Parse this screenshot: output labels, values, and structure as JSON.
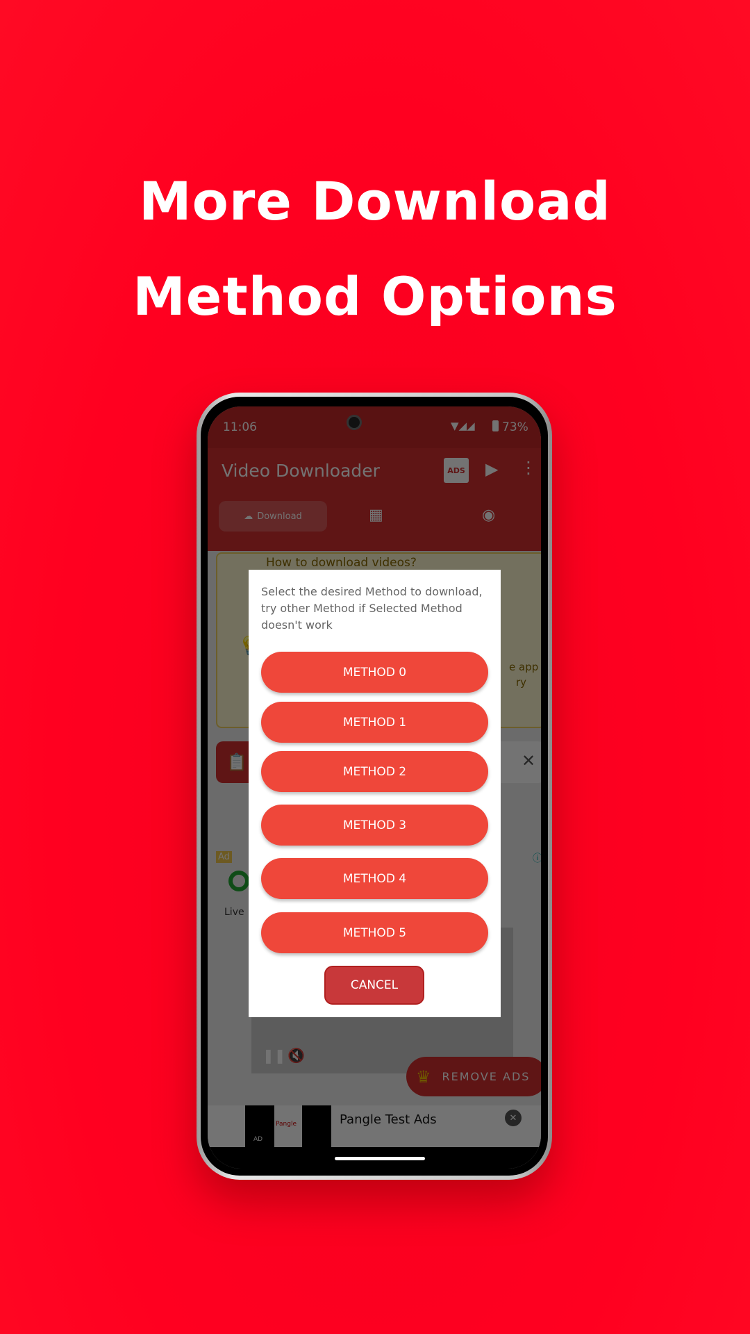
{
  "headline": {
    "line1": "More Download",
    "line2": "Method Options"
  },
  "status": {
    "time": "11:06",
    "battery": "73%"
  },
  "app": {
    "title": "Video Downloader",
    "ads_icon_label": "ADS",
    "tabs": [
      {
        "label": "Download",
        "icon": "cloud-download-icon"
      },
      {
        "icon": "puzzle-icon"
      },
      {
        "icon": "refresh-icon"
      }
    ]
  },
  "background": {
    "howto_title": "How to download videos?",
    "howto_partial_1": "e app",
    "howto_partial_2": "ry",
    "ad_badge": "Ad",
    "ad_partial": "Live",
    "remove_ads": "REMOVE ADS",
    "pangle_title": "Pangle Test Ads",
    "pangle_ad_tag": "AD",
    "pangle_logo_text": "Pangle"
  },
  "dialog": {
    "message": "Select the desired Method to download, try other Method if Selected Method doesn't work",
    "methods": [
      "METHOD 0",
      "METHOD 1",
      "METHOD 2",
      "METHOD 3",
      "METHOD 4",
      "METHOD 5"
    ],
    "cancel": "CANCEL"
  },
  "colors": {
    "background": "#ff0020",
    "button": "#ef473a",
    "cancel": "#c8383a",
    "app_primary": "#d32f2f"
  }
}
